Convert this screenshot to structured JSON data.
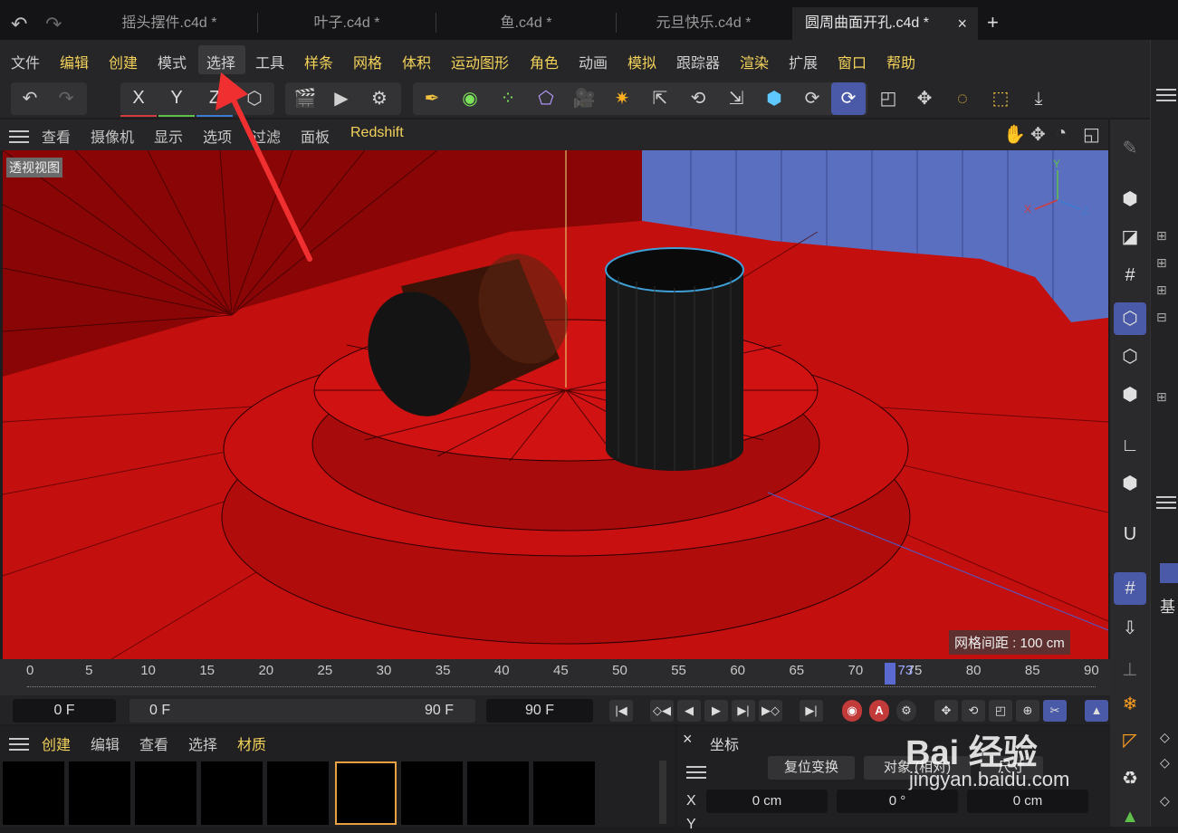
{
  "tabs": [
    {
      "label": "摇头摆件.c4d *"
    },
    {
      "label": "叶子.c4d *"
    },
    {
      "label": "鱼.c4d *"
    },
    {
      "label": "元旦快乐.c4d *"
    },
    {
      "label": "圆周曲面开孔.c4d *",
      "active": true
    }
  ],
  "tab_close": "×",
  "tab_add": "+",
  "menu": [
    "文件",
    "编辑",
    "创建",
    "模式",
    "选择",
    "工具",
    "样条",
    "网格",
    "体积",
    "运动图形",
    "角色",
    "动画",
    "模拟",
    "跟踪器",
    "渲染",
    "扩展",
    "窗口",
    "帮助"
  ],
  "toolbar": {
    "axis_x": "X",
    "axis_y": "Y",
    "axis_z": "Z"
  },
  "viewport_menu": [
    "查看",
    "摄像机",
    "显示",
    "选项",
    "过滤",
    "面板",
    "Redshift"
  ],
  "viewport": {
    "label": "透视视图",
    "grid_spacing": "网格间距 : 100 cm",
    "gizmo": {
      "x": "X",
      "y": "Y",
      "z": "Z"
    }
  },
  "timeline": {
    "ticks": [
      "0",
      "5",
      "10",
      "15",
      "20",
      "25",
      "30",
      "35",
      "40",
      "45",
      "50",
      "55",
      "60",
      "65",
      "70",
      "75",
      "80",
      "85",
      "90"
    ],
    "current": "73",
    "current_frame_fraction": 0.811
  },
  "playback": {
    "start": "0 F",
    "range_start": "0 F",
    "range_end": "90 F",
    "end": "90 F",
    "record_a": "A"
  },
  "bottom_left_menu": [
    "创建",
    "编辑",
    "查看",
    "选择",
    "材质"
  ],
  "coord_panel": {
    "close": "×",
    "title": "坐标",
    "reset_button": "复位变换",
    "mode_button": "对象 (相对)",
    "size_button": "尺寸",
    "row_x_label": "X",
    "x_pos": "0 cm",
    "x_rot": "0 °",
    "x_size": "0 cm",
    "row_y_label": "Y"
  },
  "watermark": {
    "text": "Bai 经验",
    "url": "jingyan.baidu.com"
  },
  "right_panel": {
    "label_ji": "基"
  }
}
